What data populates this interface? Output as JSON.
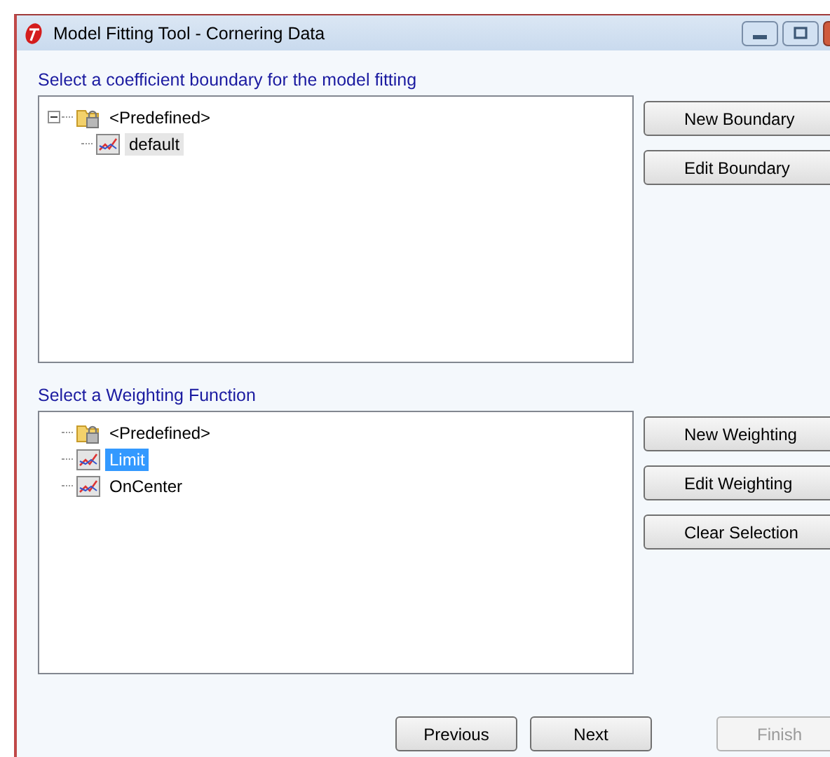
{
  "window": {
    "title": "Model Fitting Tool - Cornering Data"
  },
  "boundary": {
    "label": "Select a coefficient boundary for the model fitting",
    "tree": [
      {
        "label": "<Predefined>",
        "kind": "folder",
        "selected": false,
        "expanded": true,
        "children": [
          {
            "label": "default",
            "kind": "chart",
            "selected": true
          }
        ]
      }
    ],
    "buttons": [
      {
        "label": "New Boundary",
        "disabled": false
      },
      {
        "label": "Edit Boundary",
        "disabled": false
      }
    ]
  },
  "weighting": {
    "label": "Select a Weighting Function",
    "tree": [
      {
        "label": "<Predefined>",
        "kind": "folder",
        "selected": false
      },
      {
        "label": "Limit",
        "kind": "chart",
        "selected": true
      },
      {
        "label": "OnCenter",
        "kind": "chart",
        "selected": false
      }
    ],
    "buttons": [
      {
        "label": "New Weighting",
        "disabled": false
      },
      {
        "label": "Edit Weighting",
        "disabled": false
      },
      {
        "label": "Clear Selection",
        "disabled": false
      }
    ]
  },
  "footer": {
    "buttons": [
      {
        "label": "Previous",
        "disabled": false
      },
      {
        "label": "Next",
        "disabled": false
      },
      {
        "label": "Finish",
        "disabled": true
      }
    ]
  }
}
